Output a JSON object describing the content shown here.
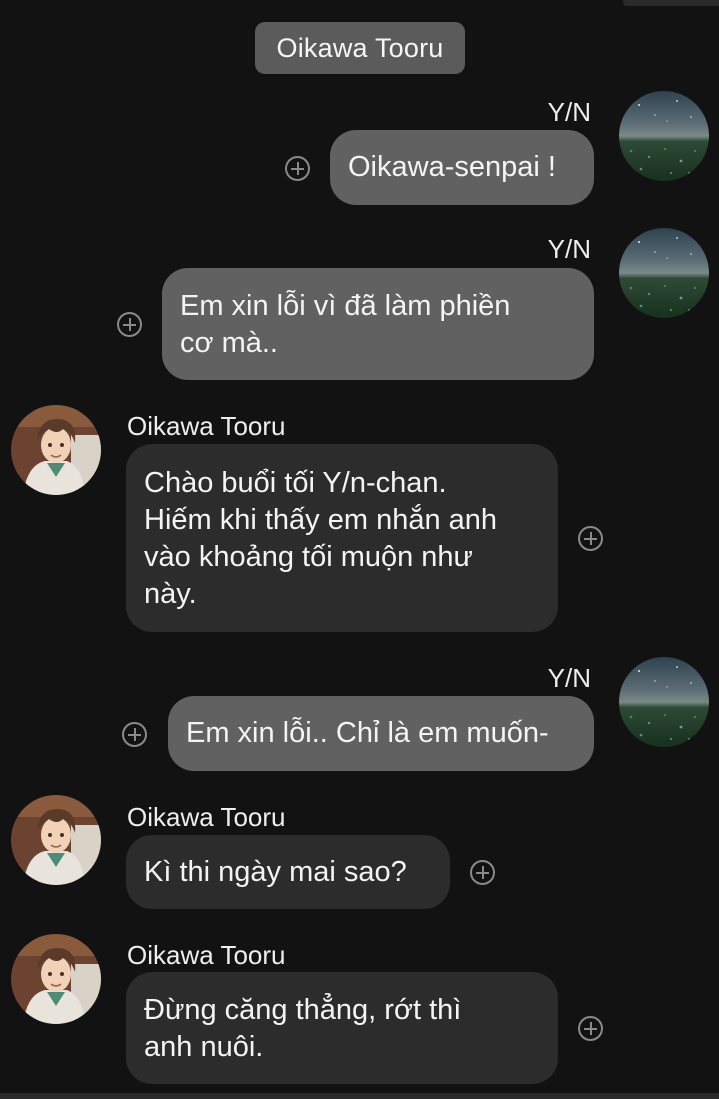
{
  "chat": {
    "title": "Oikawa Tooru",
    "messages": [
      {
        "sender": "Y/N",
        "text": "Oikawa-senpai !"
      },
      {
        "sender": "Y/N",
        "text": "Em xin lỗi vì đã làm phiền\ncơ mà.."
      },
      {
        "sender": "Oikawa Tooru",
        "text": "Chào buổi tối Y/n-chan.\nHiếm khi thấy em nhắn anh\nvào khoảng tối muộn như\nnày."
      },
      {
        "sender": "Y/N",
        "text": "Em xin lỗi.. Chỉ là em muốn-"
      },
      {
        "sender": "Oikawa Tooru",
        "text": "Kì thi ngày mai sao?"
      },
      {
        "sender": "Oikawa Tooru",
        "text": "Đừng căng thẳng, rớt thì\nanh nuôi."
      }
    ]
  },
  "colors": {
    "background": "#121212",
    "my_bubble": "#616161",
    "their_bubble": "#2c2c2c",
    "title_chip": "#5b5b5b"
  },
  "icons": {
    "react_button": "plus-circle-icon",
    "my_avatar": "starry-sky-avatar",
    "their_avatar": "anime-character-avatar"
  }
}
